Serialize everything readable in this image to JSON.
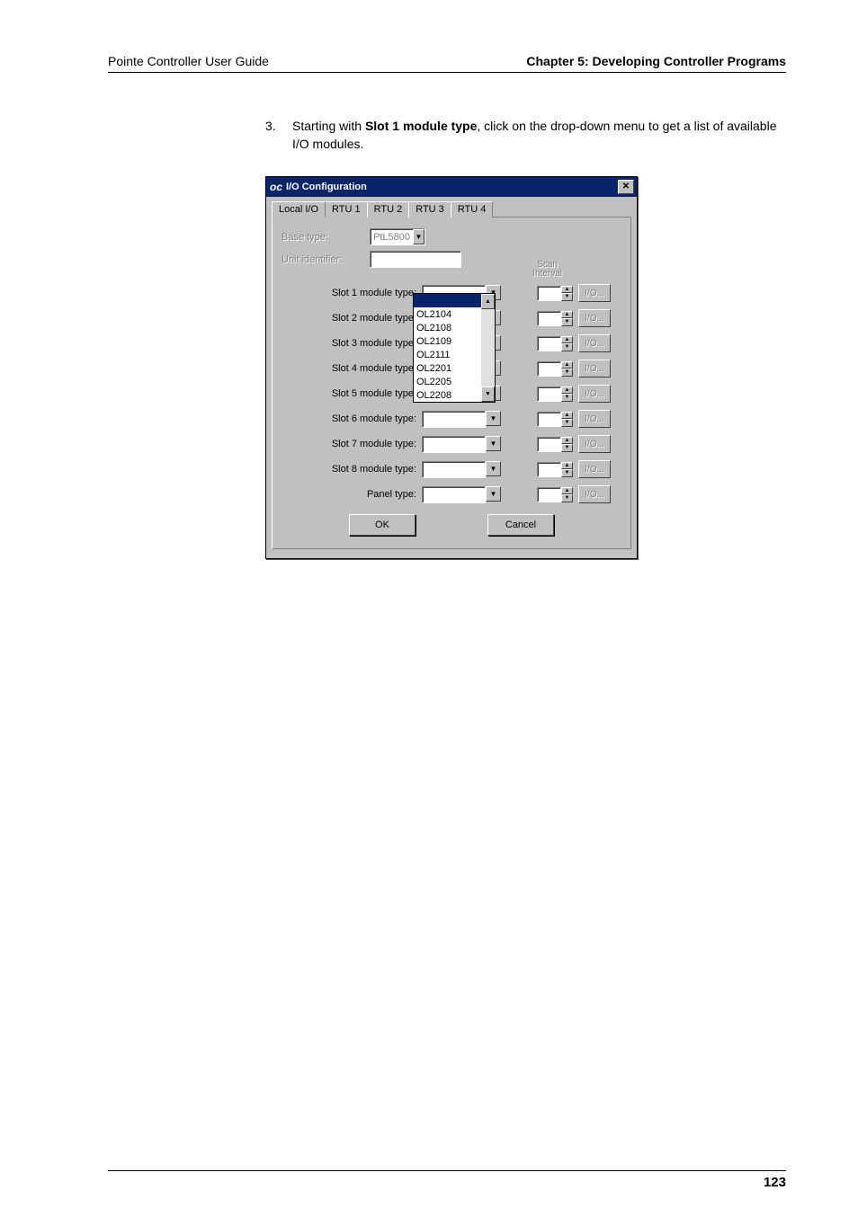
{
  "header": {
    "left": "Pointe Controller User Guide",
    "right": "Chapter 5: Developing Controller Programs"
  },
  "step": {
    "num": "3.",
    "prefix": "Starting with ",
    "bold": "Slot 1 module type",
    "suffix": ", click on the drop-down menu to get a list of available I/O modules."
  },
  "dialog": {
    "title": "I/O Configuration",
    "tabs": [
      "Local I/O",
      "RTU 1",
      "RTU 2",
      "RTU 3",
      "RTU 4"
    ],
    "base_type_label": "Base type:",
    "base_type_value": "PtL5800",
    "unit_id_label": "Unit identifier:",
    "scan_label": "Scan\nInterval",
    "slots": [
      {
        "label": "Slot 1 module type:",
        "io": "I/O..."
      },
      {
        "label": "Slot 2 module type:",
        "io": "I/O..."
      },
      {
        "label": "Slot 3 module type:",
        "io": "I/O..."
      },
      {
        "label": "Slot 4 module type:",
        "io": "I/O..."
      },
      {
        "label": "Slot 5 module type:",
        "io": "I/O..."
      },
      {
        "label": "Slot 6 module type:",
        "io": "I/O..."
      },
      {
        "label": "Slot 7 module type:",
        "io": "I/O..."
      },
      {
        "label": "Slot 8 module type:",
        "io": "I/O..."
      }
    ],
    "panel_label": "Panel type:",
    "panel_io": "I/O...",
    "dropdown_options": [
      "",
      "OL2104",
      "OL2108",
      "OL2109",
      "OL2111",
      "OL2201",
      "OL2205",
      "OL2208"
    ],
    "ok": "OK",
    "cancel": "Cancel"
  },
  "footer": {
    "page": "123"
  }
}
